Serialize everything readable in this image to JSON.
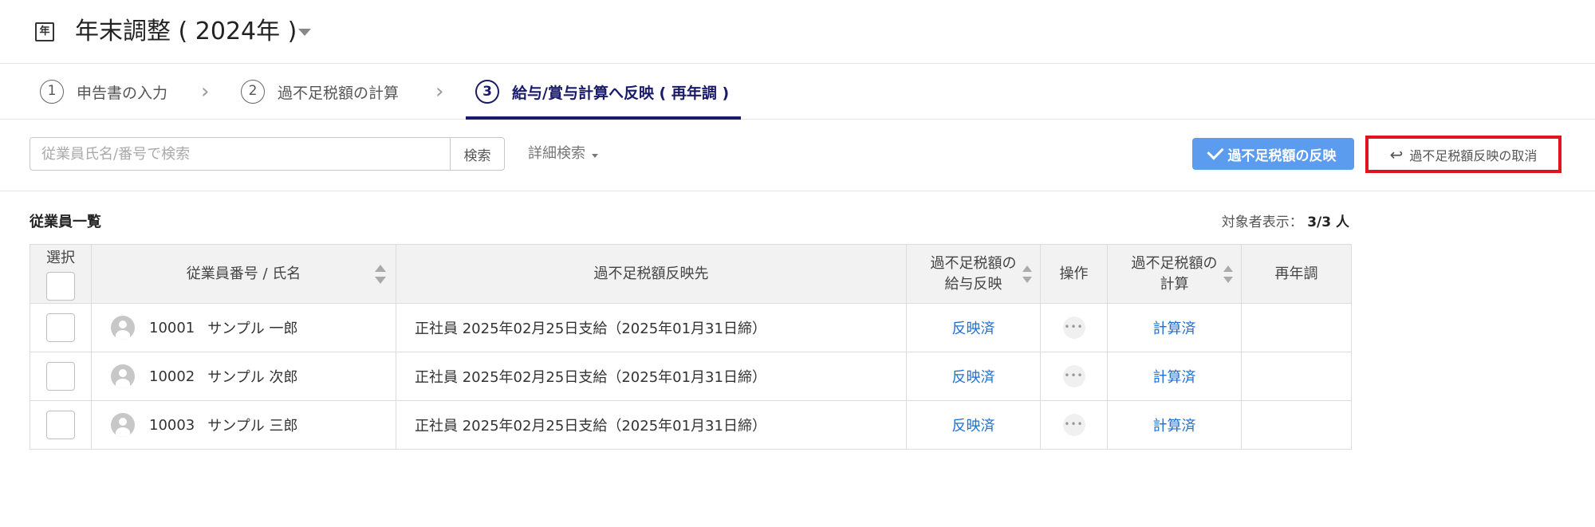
{
  "header": {
    "app_icon_glyph": "年",
    "title": "年末調整 ( 2024年 )"
  },
  "steps": [
    {
      "number": "1",
      "label": "申告書の入力"
    },
    {
      "number": "2",
      "label": "過不足税額の計算"
    },
    {
      "number": "3",
      "label": "給与/賞与計算へ反映 ( 再年調 )"
    }
  ],
  "toolbar": {
    "search_placeholder": "従業員氏名/番号で検索",
    "search_value": "",
    "search_button": "検索",
    "advanced_search": "詳細検索",
    "reflect_button": "過不足税額の反映",
    "cancel_button": "過不足税額反映の取消"
  },
  "list": {
    "title": "従業員一覧",
    "count_label": "対象者表示：",
    "count_value": "3/3 人"
  },
  "table": {
    "headers": {
      "select": "選択",
      "employee": "従業員番号 / 氏名",
      "destination": "過不足税額反映先",
      "reflect_line1": "過不足税額の",
      "reflect_line2": "給与反映",
      "operation": "操作",
      "calc_line1": "過不足税額の",
      "calc_line2": "計算",
      "readjust": "再年調"
    },
    "rows": [
      {
        "id": "10001",
        "name": "サンプル 一郎",
        "destination": "正社員 2025年02月25日支給（2025年01月31日締）",
        "reflect_status": "反映済",
        "calc_status": "計算済",
        "readjust": ""
      },
      {
        "id": "10002",
        "name": "サンプル 次郎",
        "destination": "正社員 2025年02月25日支給（2025年01月31日締）",
        "reflect_status": "反映済",
        "calc_status": "計算済",
        "readjust": ""
      },
      {
        "id": "10003",
        "name": "サンプル 三郎",
        "destination": "正社員 2025年02月25日支給（2025年01月31日締）",
        "reflect_status": "反映済",
        "calc_status": "計算済",
        "readjust": ""
      }
    ]
  },
  "colors": {
    "primary_button": "#5b9cef",
    "active_step": "#1a1a6a",
    "link": "#1f6fd1",
    "highlight_border": "#e0141e"
  },
  "icons": {
    "app": "document-icon",
    "reflect": "check-icon",
    "cancel": "undo-icon",
    "avatar": "user-avatar-icon",
    "more": "more-icon"
  }
}
